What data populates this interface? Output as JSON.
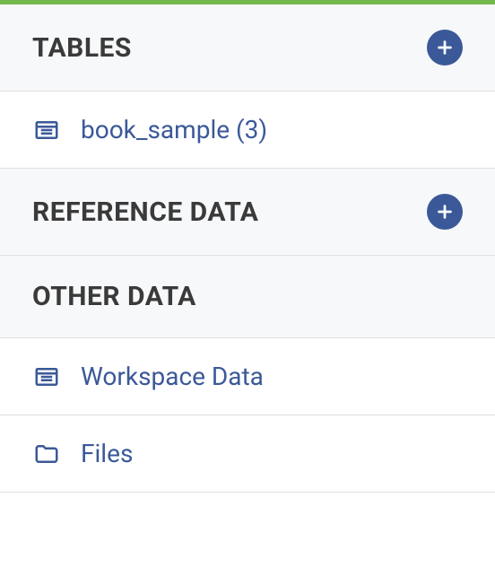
{
  "sections": {
    "tables": {
      "title": "TABLES",
      "items": [
        {
          "label": "book_sample (3)"
        }
      ]
    },
    "reference_data": {
      "title": "REFERENCE DATA"
    },
    "other_data": {
      "title": "OTHER DATA",
      "items": [
        {
          "label": "Workspace Data"
        },
        {
          "label": "Files"
        }
      ]
    }
  }
}
